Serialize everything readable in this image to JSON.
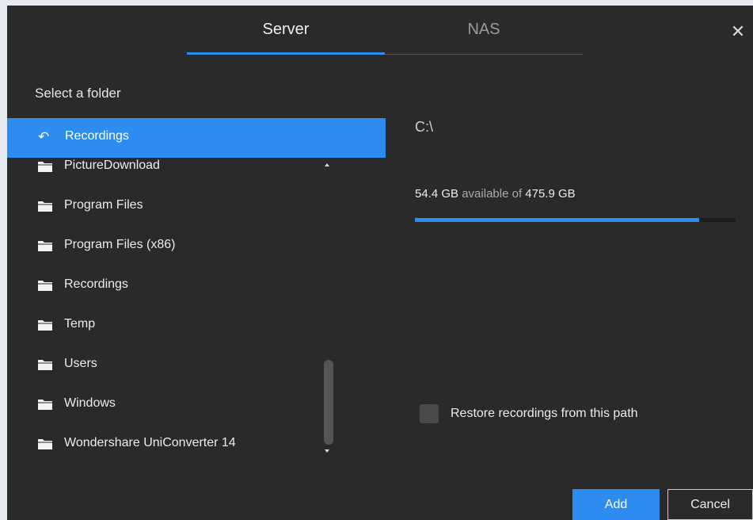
{
  "tabs": [
    {
      "label": "Server",
      "active": true
    },
    {
      "label": "NAS",
      "active": false
    }
  ],
  "close_icon": "close-icon",
  "select_label": "Select a folder",
  "current_folder": {
    "label": "Recordings",
    "icon": "back-arrow-icon"
  },
  "folders": [
    {
      "label": "PictureDownload"
    },
    {
      "label": "Program Files"
    },
    {
      "label": "Program Files (x86)"
    },
    {
      "label": "Recordings"
    },
    {
      "label": "Temp"
    },
    {
      "label": "Users"
    },
    {
      "label": "Windows"
    },
    {
      "label": "Wondershare UniConverter 14"
    }
  ],
  "drive": {
    "path": "C:\\",
    "available": "54.4 GB",
    "available_of": "available of",
    "total": "475.9 GB",
    "used_fraction": 0.886
  },
  "restore": {
    "label": "Restore recordings from this path",
    "checked": false
  },
  "buttons": {
    "add": "Add",
    "cancel": "Cancel"
  },
  "colors": {
    "accent": "#2d8cf0",
    "background": "#2a2a2a"
  }
}
